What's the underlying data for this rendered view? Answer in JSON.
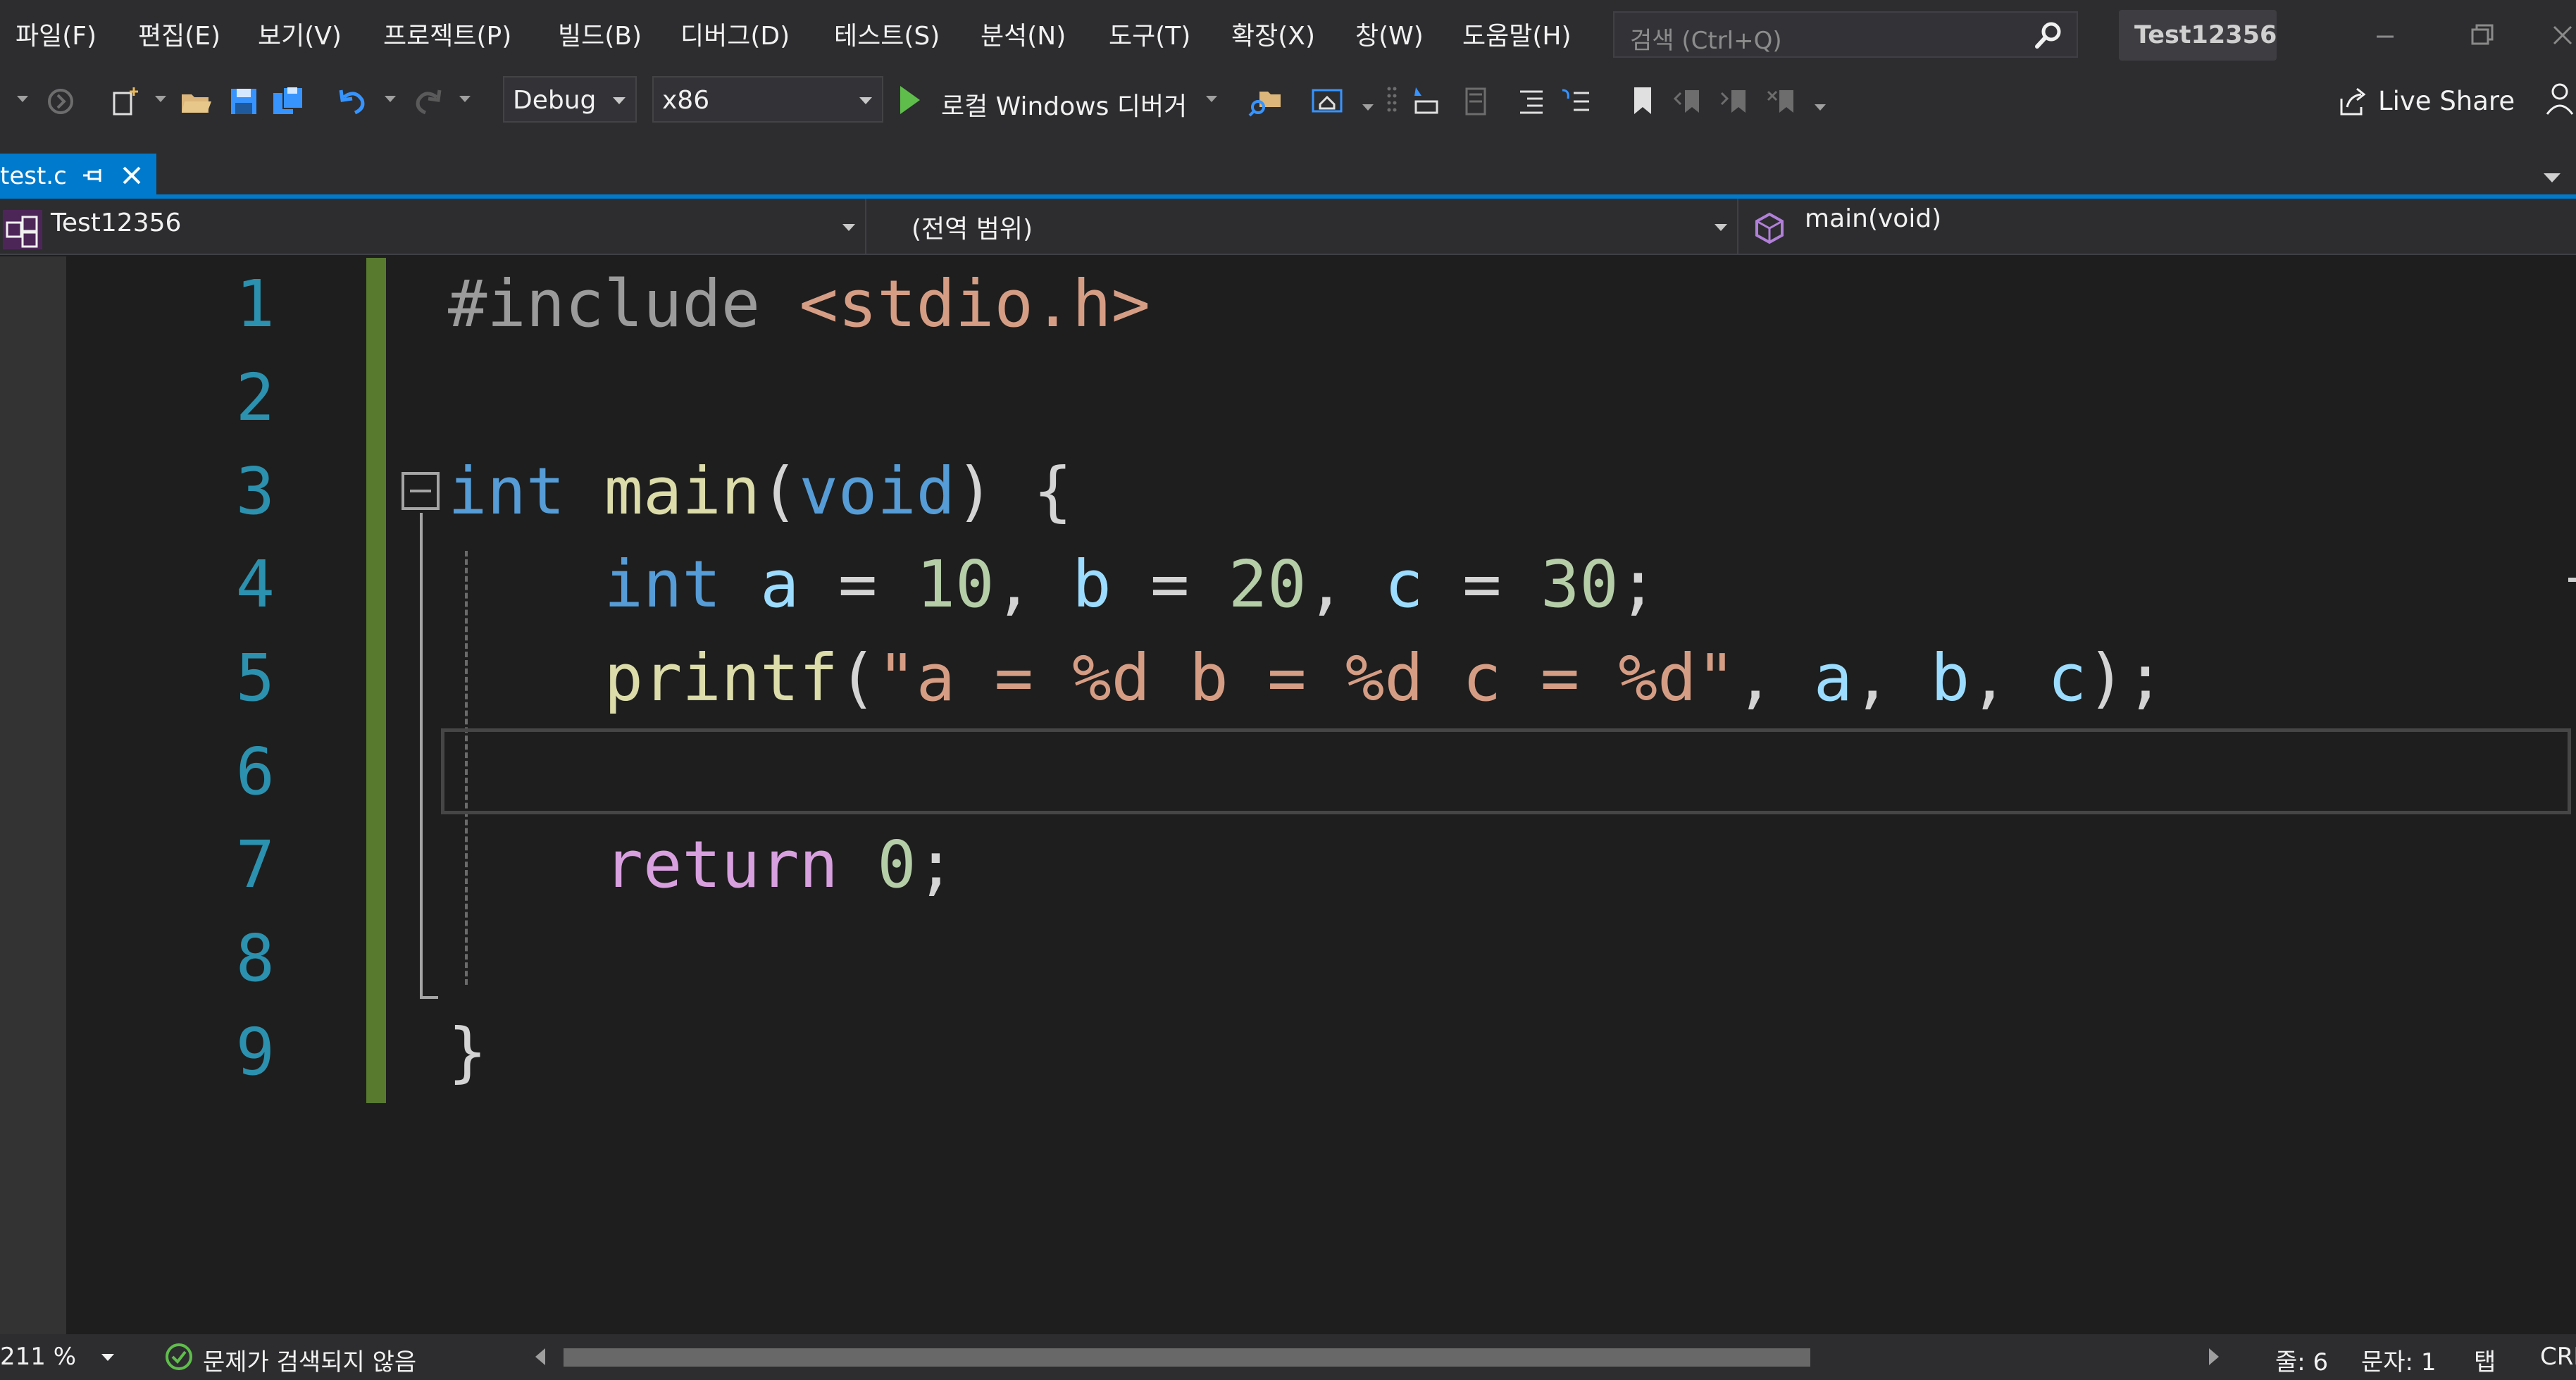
{
  "menu": {
    "items": [
      "파일(F)",
      "편집(E)",
      "보기(V)",
      "프로젝트(P)",
      "빌드(B)",
      "디버그(D)",
      "테스트(S)",
      "분석(N)",
      "도구(T)",
      "확장(X)",
      "창(W)",
      "도움말(H)"
    ],
    "search_placeholder": "검색 (Ctrl+Q)",
    "solution_name": "Test12356"
  },
  "toolbar": {
    "configuration": "Debug",
    "platform": "x86",
    "run_label": "로컬 Windows 디버거",
    "live_share": "Live Share",
    "icons": [
      "back-icon",
      "forward-icon",
      "new-project-icon",
      "open-file-icon",
      "save-icon",
      "save-all-icon",
      "undo-icon",
      "redo-icon",
      "find-in-files-icon",
      "solution-explorer-icon",
      "format-icon",
      "comment-icon",
      "bookmark-icon"
    ]
  },
  "tabs": {
    "active": "test.c"
  },
  "navbar": {
    "project": "Test12356",
    "scope": "(전역 범위)",
    "member": "main(void)"
  },
  "editor": {
    "line_numbers": [
      "1",
      "2",
      "3",
      "4",
      "5",
      "6",
      "7",
      "8",
      "9"
    ],
    "code": [
      "#include <stdio.h>",
      "",
      "int main(void) {",
      "    int a = 10, b = 20, c = 30;",
      "    printf(\"a = %d b = %d c = %d\", a, b, c);",
      "",
      "    return 0;",
      "",
      "}"
    ],
    "tokens": {
      "l1_directive": "#include",
      "l1_header": "<stdio.h>",
      "l3_type": "int",
      "l3_name": "main",
      "l3_open": "(",
      "l3_void": "void",
      "l3_close": ") {",
      "l4_type": "int",
      "l4_a": "a",
      "l4_eq1": " = ",
      "l4_n1": "10",
      "l4_sep1": ", ",
      "l4_b": "b",
      "l4_eq2": " = ",
      "l4_n2": "20",
      "l4_sep2": ", ",
      "l4_c": "c",
      "l4_eq3": " = ",
      "l4_n3": "30",
      "l4_end": ";",
      "l5_fn": "printf",
      "l5_open": "(",
      "l5_str": "\"a = %d b = %d c = %d\"",
      "l5_sep1": ", ",
      "l5_a": "a",
      "l5_sep2": ", ",
      "l5_b": "b",
      "l5_sep3": ", ",
      "l5_c": "c",
      "l5_end": ");",
      "l7_kw": "return",
      "l7_num": "0",
      "l7_end": ";",
      "l9_brace": "}"
    },
    "current_line": 6
  },
  "status": {
    "zoom": "211 %",
    "issues": "문제가 검색되지 않음",
    "line": "줄: 6",
    "column": "문자: 1",
    "indent": "탭",
    "eol": "CRLF"
  },
  "colors": {
    "accent": "#007acc",
    "background": "#1e1e1e",
    "chrome": "#2d2d30",
    "change_bar": "#577a2e",
    "line_number": "#2b91af",
    "keyword": "#569cd6",
    "function": "#dcdcaa",
    "variable": "#9cdcfe",
    "number": "#b5cea8",
    "string": "#d69d85",
    "control": "#d8a0df"
  }
}
